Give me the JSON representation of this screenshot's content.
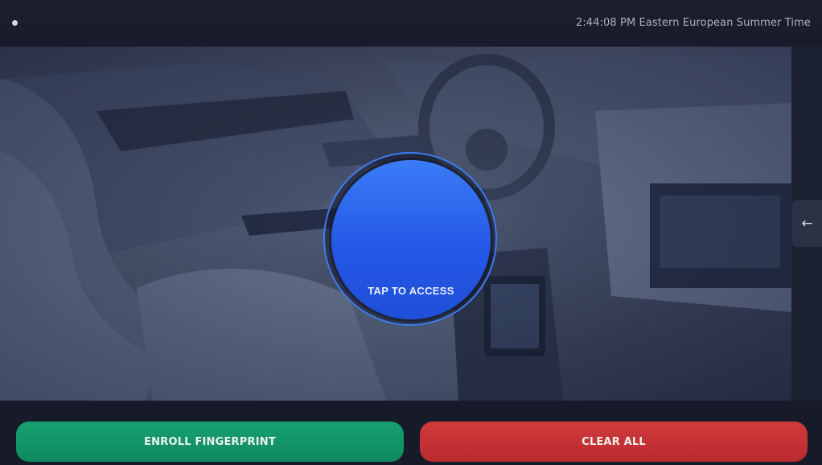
{
  "status_bar": {
    "clock": "2:44:08 PM Eastern European Summer Time"
  },
  "background": {
    "image": "car-interior"
  },
  "center": {
    "access_label": "TAP TO ACCESS"
  },
  "drawer": {
    "handle_icon": "←"
  },
  "actions": {
    "enroll_label": "ENROLL FINGERPRINT",
    "clear_label": "CLEAR ALL"
  },
  "colors": {
    "accent_blue": "#2a62ee",
    "enroll_green": "#12956a",
    "clear_red": "#c83236"
  }
}
